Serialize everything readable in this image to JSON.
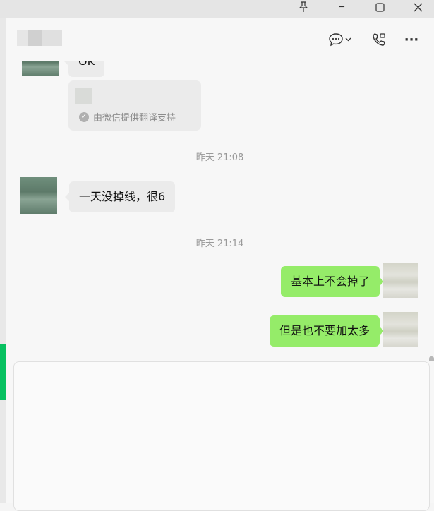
{
  "window": {
    "controls": {
      "pin": "pin-icon",
      "minimize": "─",
      "maximize": "☐",
      "close": "✕"
    }
  },
  "header": {
    "chat_name": "",
    "icons": [
      "chat-bubble-icon",
      "dropdown-icon",
      "video-call-icon",
      "more-icon"
    ],
    "more_label": "···"
  },
  "messages": {
    "m1": {
      "sender": "them",
      "text": "OK"
    },
    "translation": {
      "note": "由微信提供翻译支持"
    },
    "ts1": "昨天 21:08",
    "m2": {
      "sender": "them",
      "text": "一天没掉线，很6"
    },
    "ts2": "昨天 21:14",
    "m3": {
      "sender": "me",
      "text": "基本上不会掉了"
    },
    "m4": {
      "sender": "me",
      "text": "但是也不要加太多"
    }
  },
  "colors": {
    "my_bubble": "#95ec69",
    "their_bubble": "#ebebeb",
    "accent": "#07c160"
  }
}
